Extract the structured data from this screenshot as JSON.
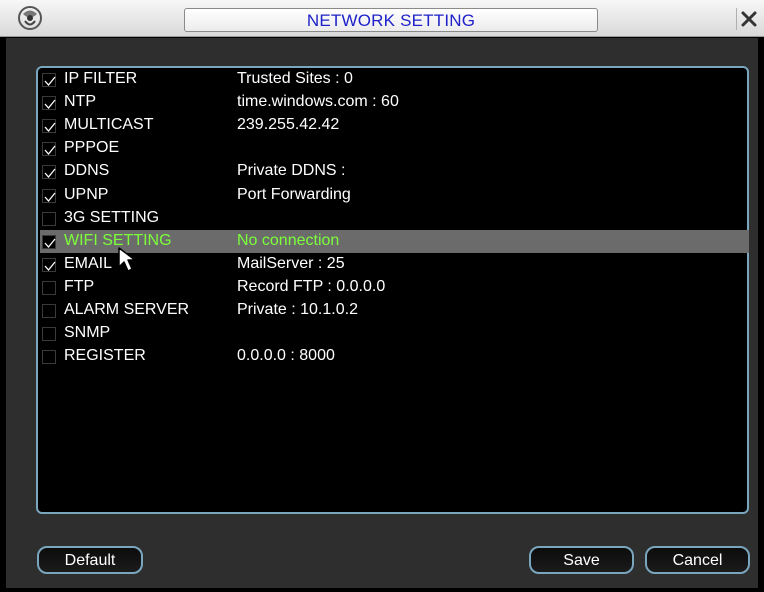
{
  "window": {
    "title": "NETWORK SETTING"
  },
  "items": [
    {
      "name": "IP FILTER",
      "value": "Trusted Sites : 0",
      "checked": true
    },
    {
      "name": "NTP",
      "value": "time.windows.com : 60",
      "checked": true
    },
    {
      "name": "MULTICAST",
      "value": "239.255.42.42",
      "checked": true
    },
    {
      "name": "PPPOE",
      "value": "",
      "checked": true
    },
    {
      "name": "DDNS",
      "value": "Private DDNS :",
      "checked": true
    },
    {
      "name": "UPNP",
      "value": "Port Forwarding",
      "checked": true
    },
    {
      "name": "3G SETTING",
      "value": "",
      "checked": false
    },
    {
      "name": "WIFI SETTING",
      "value": "No connection",
      "checked": true,
      "selected": true
    },
    {
      "name": "EMAIL",
      "value": "MailServer : 25",
      "checked": true
    },
    {
      "name": "FTP",
      "value": "Record FTP : 0.0.0.0",
      "checked": false
    },
    {
      "name": "ALARM SERVER",
      "value": "Private : 10.1.0.2",
      "checked": false
    },
    {
      "name": "SNMP",
      "value": "",
      "checked": false
    },
    {
      "name": "REGISTER",
      "value": "0.0.0.0 : 8000",
      "checked": false
    }
  ],
  "buttons": {
    "default": "Default",
    "save": "Save",
    "cancel": "Cancel"
  },
  "colors": {
    "title": "#1e22c8",
    "selected_text": "#7cff3a",
    "selected_row": "#6b6b6b",
    "accent_border": "#7aa6bd"
  },
  "icons": {
    "logo": "dvr-logo-icon",
    "close": "close-icon",
    "cursor": "mouse-pointer-icon",
    "check": "checkmark-icon"
  }
}
